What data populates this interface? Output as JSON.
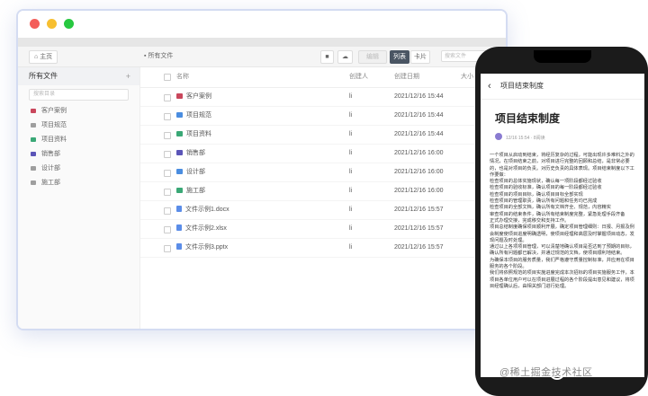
{
  "toolbar": {
    "home": "主页",
    "breadcrumb": "所有文件",
    "buttons": [
      "编辑",
      "列表",
      "卡片"
    ],
    "search_placeholder": "搜索文件"
  },
  "sidebar": {
    "title": "所有文件",
    "add": "+",
    "search_placeholder": "搜索目录",
    "items": [
      {
        "label": "客户案例",
        "color": "#c9475c"
      },
      {
        "label": "项目规范",
        "color": "#9e9e9e"
      },
      {
        "label": "项目资料",
        "color": "#3aa876"
      },
      {
        "label": "销售部",
        "color": "#5b55b8"
      },
      {
        "label": "设计部",
        "color": "#9e9e9e"
      },
      {
        "label": "施工部",
        "color": "#9e9e9e"
      }
    ]
  },
  "table": {
    "headers": {
      "name": "名称",
      "creator": "创建人",
      "date": "创建日期",
      "size": "大小"
    },
    "rows": [
      {
        "name": "客户案例",
        "creator": "li",
        "date": "2021/12/16 15:44",
        "size": "",
        "type": "folder",
        "color": "#c9475c"
      },
      {
        "name": "项目规范",
        "creator": "li",
        "date": "2021/12/16 15:44",
        "size": "",
        "type": "folder",
        "color": "#4a8de0"
      },
      {
        "name": "项目资料",
        "creator": "li",
        "date": "2021/12/16 15:44",
        "size": "",
        "type": "folder",
        "color": "#3aa876"
      },
      {
        "name": "销售部",
        "creator": "li",
        "date": "2021/12/16 16:00",
        "size": "",
        "type": "folder",
        "color": "#5b55b8"
      },
      {
        "name": "设计部",
        "creator": "li",
        "date": "2021/12/16 16:00",
        "size": "",
        "type": "folder",
        "color": "#4a8de0"
      },
      {
        "name": "施工部",
        "creator": "li",
        "date": "2021/12/16 16:00",
        "size": "",
        "type": "folder",
        "color": "#3aa876"
      },
      {
        "name": "文件示例1.docx",
        "creator": "li",
        "date": "2021/12/16 15:57",
        "size": "",
        "type": "file"
      },
      {
        "name": "文件示例2.xlsx",
        "creator": "li",
        "date": "2021/12/16 15:57",
        "size": "",
        "type": "file"
      },
      {
        "name": "文件示例3.pptx",
        "creator": "li",
        "date": "2021/12/16 15:57",
        "size": "",
        "type": "file"
      }
    ]
  },
  "phone": {
    "nav_title": "项目结束制度",
    "doc_title": "项目结束制度",
    "meta": "12/16 15:54 · 8阅读",
    "paragraphs": [
      "一个项目从启动到结束，将经历复杂的过程，可能出现许多难料之外的情况，在项目结束之前，对项目进行完整的回顾和总结，是非常必要的，也是对项目的负责。对历史负责的具体表现。项目结束制度以下工作要做：",
      "检查项目的总体实施现状，确认每一项阶段都经过验收",
      "检查项目的验收标准，确认项目的每一阶段都经过验收",
      "检查项目的项目目标，确认项目目标全部实现",
      "检查项目的管理职责，确认所有问题和任务均已完成",
      "检查项目的全部文档，确认所有文档齐全、规范，内容精实",
      "审查项目的结束条件，确认所有结束制度完整，紧急处理手段齐备",
      "正式办理交接，完成移交和支持工作。",
      "项目总结制度确保项目顺利开展，确定项目管理细则：日报、月报及例会制度使项目进度明确透明，使项目经理和高层及时掌握项目动态，发现问题及时处理。",
      "通过以上各项项目管理，可以清楚地确认项目是否达到了预期的目标，确认所有问题都已解决，并通过规范的文档，使项目顺利地结束。",
      "为确保本项目的服务质量，我们严格遵守质量控制标准，并应用在项目服务的各个阶段。",
      "我们将依照规范的项目实施进度完成本次招标的项目实施服务工作，本项目各单位用户可以在项目进展过程的各个阶段提出意见和建议，将项目经理确认后，由相关部门进行处理。"
    ]
  },
  "watermark": "@稀土掘金技术社区"
}
